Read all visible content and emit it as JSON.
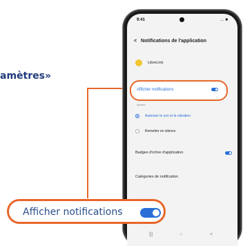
{
  "callout": {
    "caption": "amètres»"
  },
  "phone": {
    "status": {
      "time": "9:41",
      "icons": "… ■"
    },
    "header": {
      "back": "<",
      "title": "Notifications de l'application"
    },
    "app": {
      "name": "LibreLink"
    },
    "notif_row": {
      "label": "Afficher notifications",
      "enabled": true
    },
    "section_label": "Alertes",
    "options": [
      {
        "label": "Autoriser le son et la vibration",
        "selected": true
      },
      {
        "label": "Remettre en silence",
        "selected": false
      }
    ],
    "badges": {
      "label": "Badges d'icône d'application",
      "enabled": true
    },
    "categories": {
      "label": "Catégories de notification"
    },
    "nav": {
      "left": "|||",
      "center": "○",
      "right": "<"
    }
  },
  "big_callout": {
    "label": "Afficher notifications",
    "enabled": true
  },
  "colors": {
    "accent": "#e8662a",
    "toggle_on": "#2a6fd6",
    "caption_text": "#1f3b7a"
  }
}
